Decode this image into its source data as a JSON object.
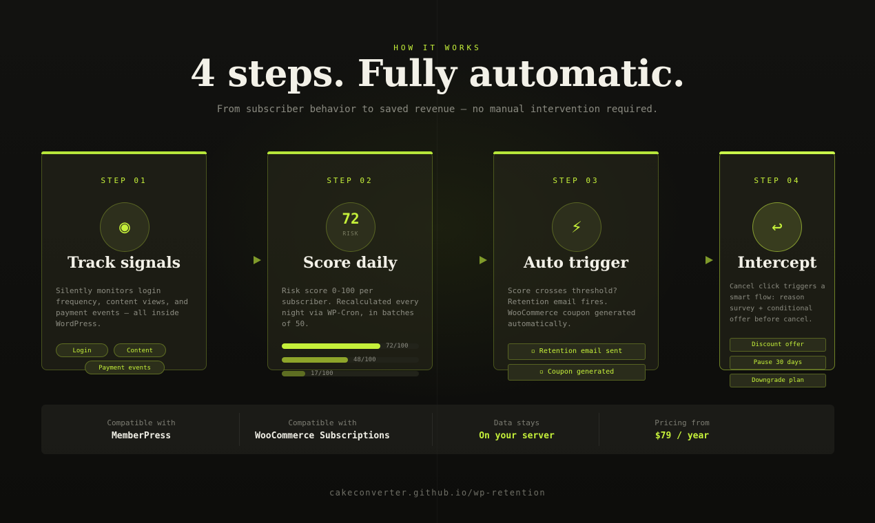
{
  "header": {
    "eyebrow": "HOW IT WORKS",
    "title": "4 steps. Fully automatic.",
    "subtitle": "From subscriber behavior to saved revenue — no manual intervention required."
  },
  "steps": [
    {
      "label": "STEP 01",
      "icon": "target-signal-icon",
      "icon_glyph": "◉",
      "title": "Track signals",
      "description": "Silently monitors login frequency, content views, and payment events — all inside WordPress.",
      "tags": [
        "Login",
        "Content",
        "Payment events"
      ]
    },
    {
      "label": "STEP 02",
      "risk_value": "72",
      "risk_label": "RISK",
      "title": "Score daily",
      "description": "Risk score 0-100 per subscriber. Recalculated every night via WP-Cron, in batches of 50.",
      "bars": [
        {
          "value": 72,
          "label": "72/100",
          "color": "#c5f03a"
        },
        {
          "value": 48,
          "label": "48/100",
          "color": "#8ea52a"
        },
        {
          "value": 17,
          "label": "17/100",
          "color": "#5e6e22"
        }
      ]
    },
    {
      "label": "STEP 03",
      "icon": "lightning-icon",
      "icon_glyph": "⚡",
      "title": "Auto trigger",
      "description": "Score crosses threshold? Retention email fires. WooCommerce coupon generated automatically.",
      "chips": [
        "▫ Retention email sent",
        "▫ Coupon generated"
      ]
    },
    {
      "label": "STEP 04",
      "icon": "return-arrow-icon",
      "icon_glyph": "↩",
      "title": "Intercept",
      "description": "Cancel click triggers a smart flow: reason survey + conditional offer before cancel.",
      "options": [
        "Discount offer",
        "Pause 30 days",
        "Downgrade plan"
      ]
    }
  ],
  "stats": [
    {
      "label": "Compatible with",
      "value": "MemberPress"
    },
    {
      "label": "Compatible with",
      "value": "WooCommerce Subscriptions"
    },
    {
      "label": "Data stays",
      "value": "On your server"
    },
    {
      "label": "Pricing from",
      "value": "$79 / year"
    }
  ],
  "footer": {
    "url": "cakeconverter.github.io/wp-retention"
  },
  "colors": {
    "accent": "#c5f03a",
    "background": "#0e0e0c",
    "text": "#f3f1e8",
    "muted": "#8b8b80"
  }
}
